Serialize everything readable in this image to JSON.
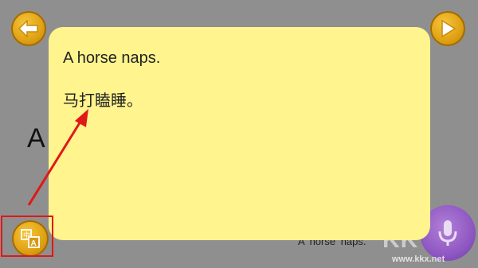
{
  "navigation": {
    "back_icon": "arrow-left-icon",
    "next_icon": "play-right-icon"
  },
  "translate_button": {
    "icon": "translate-icon",
    "highlight_color": "#e01818"
  },
  "page": {
    "visible_letter": "A",
    "caption": "A horse naps."
  },
  "popup": {
    "background": "#fff48d",
    "english_text": "A horse naps.",
    "chinese_text": "马打瞌睡。"
  },
  "mic_button": {
    "icon": "microphone-icon",
    "color": "#8f58c2"
  },
  "watermark": {
    "logo_text": "KK",
    "url": "www.kkx.net"
  },
  "annotation": {
    "arrow_color": "#e01818"
  }
}
